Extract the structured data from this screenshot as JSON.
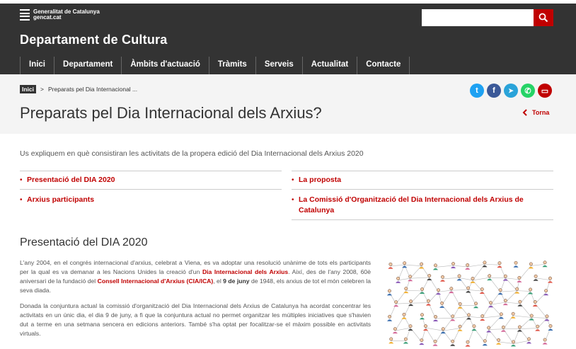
{
  "header": {
    "logo_line1": "Generalitat de Catalunya",
    "logo_line2": "gencat.cat",
    "department": "Departament de Cultura",
    "search_placeholder": "",
    "search_icon": "search-icon"
  },
  "nav": [
    "Inici",
    "Departament",
    "Àmbits d'actuació",
    "Tràmits",
    "Serveis",
    "Actualitat",
    "Contacte"
  ],
  "breadcrumb": {
    "home": "Inici",
    "separator": ">",
    "current": "Preparats pel Dia Internacional ..."
  },
  "social": [
    {
      "name": "twitter-icon",
      "color": "#1da1f2",
      "glyph": "t"
    },
    {
      "name": "facebook-icon",
      "color": "#3b5998",
      "glyph": "f"
    },
    {
      "name": "telegram-icon",
      "color": "#2aa3d9",
      "glyph": "➤"
    },
    {
      "name": "whatsapp-icon",
      "color": "#25d366",
      "glyph": "✆"
    },
    {
      "name": "print-icon",
      "color": "#c00000",
      "glyph": "▭"
    }
  ],
  "page": {
    "title": "Preparats pel Dia Internacional dels Arxius?",
    "back_label": "Torna",
    "intro": "Us expliquem en què consistiran les activitats de la propera edició del Dia Internacional dels Arxius 2020"
  },
  "links_left": [
    "Presentació del DIA 2020",
    "Arxius participants"
  ],
  "links_right": [
    "La proposta",
    "La Comissió d'Organització del Dia Internacional dels Arxius de Catalunya"
  ],
  "section": {
    "title": "Presentació del DIA 2020",
    "p1_a": "L'any 2004, en el congrés internacional d'arxius, celebrat a Viena, es va adoptar una resolució unànime de tots els participants per la qual es va demanar a les Nacions Unides la creació d'un ",
    "p1_link1": "Dia Internacional dels Arxius",
    "p1_b": ". Així, des de l'any 2008, 60è aniversari de la fundació del ",
    "p1_link2": "Consell Internacional d'Arxius (CIA/ICA)",
    "p1_c": ", el ",
    "p1_bold": "9 de juny",
    "p1_d": " de 1948, els arxius de tot el món celebren la seva diada.",
    "p2": "Donada la conjuntura actual la comissió d'organització del Dia Internacional dels Arxius de Catalunya ha acordat concentrar les activitats en un únic dia, el dia 9 de juny, a fi que la conjuntura actual no permet organitzar les múltiples iniciatives que s'havien dut a terme en una setmana sencera en edicions anteriors. També s'ha optat per focalitzar-se el màxim possible en activitats virtuals."
  },
  "colors": {
    "brand_red": "#c00000",
    "header_bg": "#333333",
    "band_bg": "#f4f4f4"
  }
}
